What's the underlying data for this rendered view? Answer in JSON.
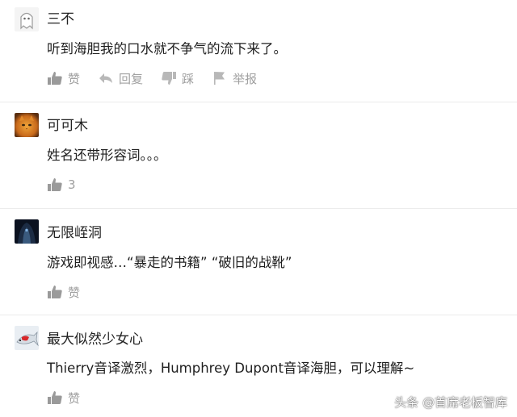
{
  "comments": [
    {
      "username": "三不",
      "avatar_icon": "ghost-avatar-icon",
      "text": "听到海胆我的口水就不争气的流下来了。",
      "actions": [
        {
          "icon": "thumbs-up-icon",
          "label": "赞"
        },
        {
          "icon": "reply-icon",
          "label": "回复"
        },
        {
          "icon": "thumbs-down-icon",
          "label": "踩"
        },
        {
          "icon": "flag-icon",
          "label": "举报"
        }
      ]
    },
    {
      "username": "可可木",
      "avatar_icon": "cat-avatar-icon",
      "text": "姓名还带形容词。。。",
      "actions": [
        {
          "icon": "thumbs-up-icon",
          "label": "3"
        }
      ]
    },
    {
      "username": "无限峌洞",
      "avatar_icon": "dark-figure-avatar-icon",
      "text": "游戏即视感…“暴走的书籍”  “破旧的战靴”",
      "actions": [
        {
          "icon": "thumbs-up-icon",
          "label": "赞"
        }
      ]
    },
    {
      "username": "最大似然少女心",
      "avatar_icon": "fish-avatar-icon",
      "text": "Thierry音译激烈，Humphrey Dupont音译海胆，可以理解~",
      "actions": [
        {
          "icon": "thumbs-up-icon",
          "label": "赞"
        }
      ]
    }
  ],
  "watermark": "头条 @首席老板智库",
  "colors": {
    "action_gray": "#9a9a9a",
    "divider": "#ececec",
    "text": "#222222"
  }
}
